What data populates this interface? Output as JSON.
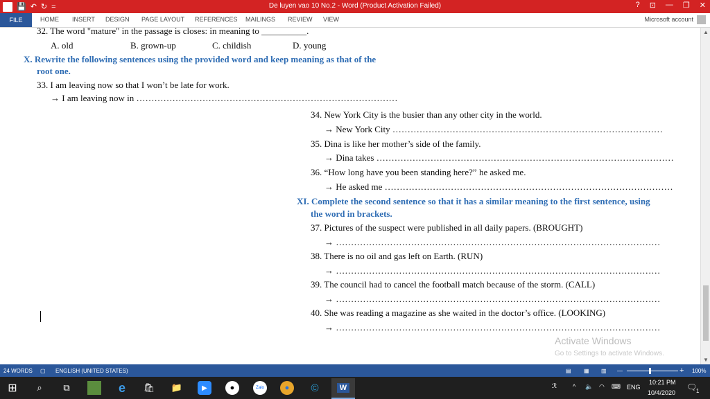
{
  "window": {
    "title": "De luyen vao 10 No.2 - Word (Product Activation Failed)",
    "help": "?",
    "ribbon_display": "⊡",
    "minimize": "—",
    "restore": "❐",
    "close": "✕"
  },
  "qat": {
    "logo": "W",
    "save": "💾",
    "undo": "↶",
    "redo": "↻",
    "customize": "="
  },
  "ribbon": {
    "tabs": [
      "FILE",
      "HOME",
      "INSERT",
      "DESIGN",
      "PAGE LAYOUT",
      "REFERENCES",
      "MAILINGS",
      "REVIEW",
      "VIEW"
    ],
    "account": "Microsoft account"
  },
  "document": {
    "q32": "32. The word \"mature\" in the passage is closes: in meaning to __________.",
    "q32_options": [
      "A. old",
      "B. grown-up",
      "C. childish",
      "D. young"
    ],
    "section_x_1": "X. Rewrite the following sentences using the provided word and keep meaning as that of the",
    "section_x_2": "root one.",
    "q33": "33. I am leaving now so that I won’t be late for work.",
    "q33_ans": "→ I am leaving now in ……………………………………………………………………………",
    "q34": "34. New York City is the busier than any other city in the world.",
    "q34_ans": "→ New York City ………………………………………………………………………………",
    "q35": "35. Dina is like her mother’s side of the family.",
    "q35_ans": "→ Dina takes ………………………………………………………………………………………",
    "q36": "36. “How long have you been standing here?” he asked me.",
    "q36_ans": "→ He asked me ……………………………………………………………………………………",
    "section_xi_1": "XI. Complete the second sentence so that it has a similar meaning to the first sentence, using",
    "section_xi_2": "the word in brackets.",
    "q37": "37. Pictures of the suspect were published in all daily papers. (BROUGHT)",
    "q37_ans": "→ ………………………………………………………………………………………………",
    "q38": "38. There is no oil and gas left on Earth. (RUN)",
    "q38_ans": "→ ………………………………………………………………………………………………",
    "q39": "39. The council had to cancel the football match because of the storm. (CALL)",
    "q39_ans": "→ ………………………………………………………………………………………………",
    "q40": "40. She was reading a magazine as she waited in the doctor’s office. (LOOKING)",
    "q40_ans": "→ ………………………………………………………………………………………………"
  },
  "watermark": {
    "line1": "Activate Windows",
    "line2": "Go to Settings to activate Windows."
  },
  "statusbar": {
    "words": "24 WORDS",
    "language": "ENGLISH (UNITED STATES)",
    "zoom": "100%",
    "zoom_minus": "—",
    "zoom_plus": "+"
  },
  "taskbar": {
    "start": "⊞",
    "search": "⌕",
    "taskview": "⧉",
    "apps": [
      "minecraft-icon",
      "edge-icon",
      "store-icon",
      "explorer-icon",
      "zoom-icon",
      "obs-icon",
      "zalo-icon",
      "chrome-icon",
      "ccleaner-icon",
      "word-icon"
    ],
    "zalo_label": "Zalo",
    "language": "ENG",
    "time": "10:21 PM",
    "date": "10/4/2020",
    "notifications": "1"
  }
}
